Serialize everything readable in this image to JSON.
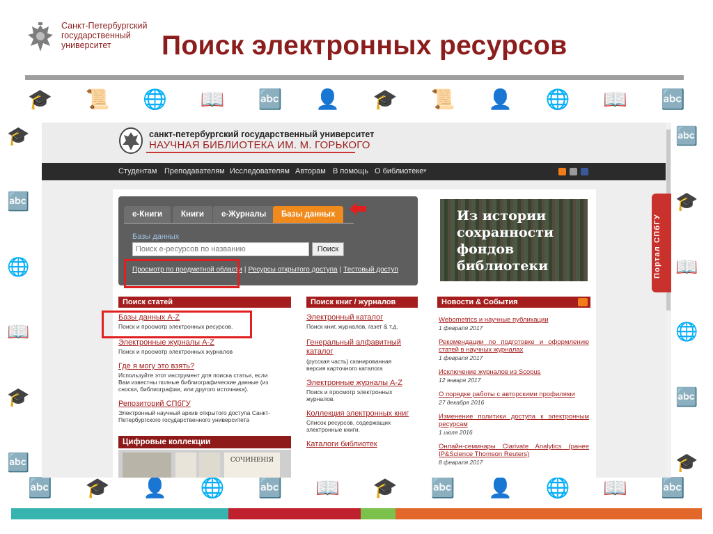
{
  "slide": {
    "title": "Поиск электронных ресурсов",
    "university_name": [
      "Санкт-Петербургский",
      "государственный",
      "университет"
    ],
    "side_tab": "Портал СПбГУ",
    "colors": {
      "title": "#8c1d1d",
      "accent_red": "#a51d1d",
      "orange": "#f08a1c",
      "bar_teal": "#37b3b0",
      "bar_red": "#c01f2e",
      "bar_green": "#7cc14b",
      "bar_orange": "#e2672a"
    }
  },
  "library": {
    "line1": "санкт-петербургский государственный университет",
    "line2": "НАУЧНАЯ БИБЛИОТЕКА ИМ. М. ГОРЬКОГО",
    "nav": [
      "Студентам",
      "Преподавателям",
      "Исследователям",
      "Авторам",
      "В помощь",
      "О библиотеке"
    ],
    "nav_dropdown_icon": "chevron-down-icon",
    "social_icons": [
      "rss-icon",
      "twitter-icon",
      "facebook-icon"
    ]
  },
  "search": {
    "tabs": [
      "е-Книги",
      "Книги",
      "е-Журналы",
      "Базы данных"
    ],
    "active_tab": "Базы данных",
    "label": "Базы данных",
    "placeholder": "Поиск е-ресурсов по названию",
    "button": "Поиск",
    "links": [
      "Просмотр по предметной области",
      "Ресурсы открытого доступа",
      "Тестовый доступ"
    ]
  },
  "banner": {
    "lines": [
      "Из истории",
      "сохранности",
      "фондов",
      "библиотеки"
    ]
  },
  "articles": {
    "header": "Поиск статей",
    "items": [
      {
        "title": "Базы данных A-Z",
        "desc": "Поиск и просмотр электронных ресурсов."
      },
      {
        "title": "Электронные журналы A-Z",
        "desc": "Поиск и просмотр электронных журналов"
      },
      {
        "title": "Где я могу это взять?",
        "desc": "Используйте этот инструмент для поиска статьи, если Вам известны полные библиографические данные (из сноски, библиографии, или другого источника)."
      },
      {
        "title": "Репозиторий СПбГУ",
        "desc": "Электронный научный архив открытого доступа Санкт-Петербургского государственного университета"
      }
    ]
  },
  "books": {
    "header": "Поиск книг / журналов",
    "items": [
      {
        "title": "Электронный каталог",
        "desc": "Поиск книг, журналов, газет & т.д."
      },
      {
        "title": "Генеральный алфавитный каталог",
        "desc": "(русская часть) сканированная версия карточного каталога"
      },
      {
        "title": "Электронные журналы A-Z",
        "desc": "Поиск и просмотр электронных журналов."
      },
      {
        "title": "Коллекция электронных книг",
        "desc": "Список ресурсов, содержащих электронные книги."
      },
      {
        "title": "Каталоги библиотек",
        "desc": ""
      }
    ]
  },
  "news": {
    "header": "Новости & События",
    "items": [
      {
        "title": "Webometrics и научные публикации",
        "date": "1 февраля 2017"
      },
      {
        "title": "Рекомендации по подготовке и оформлению статей в научных журналах",
        "date": "1 февраля 2017"
      },
      {
        "title": "Исключение журналов из Scopus",
        "date": "12 января 2017"
      },
      {
        "title": "О порядке работы с авторскими профилями",
        "date": "27 декабря 2016"
      },
      {
        "title": "Изменение политики доступа к электронным ресурсам",
        "date": "1 июля 2016"
      },
      {
        "title": "Онлайн-семинары Clarivate Analytics (ранее IP&Science Thomson Reuters)",
        "date": "8 февраля 2017"
      }
    ]
  },
  "digital": {
    "header": "Цифровые коллекции",
    "book_title": "СОЧИНЕНІЯ"
  }
}
